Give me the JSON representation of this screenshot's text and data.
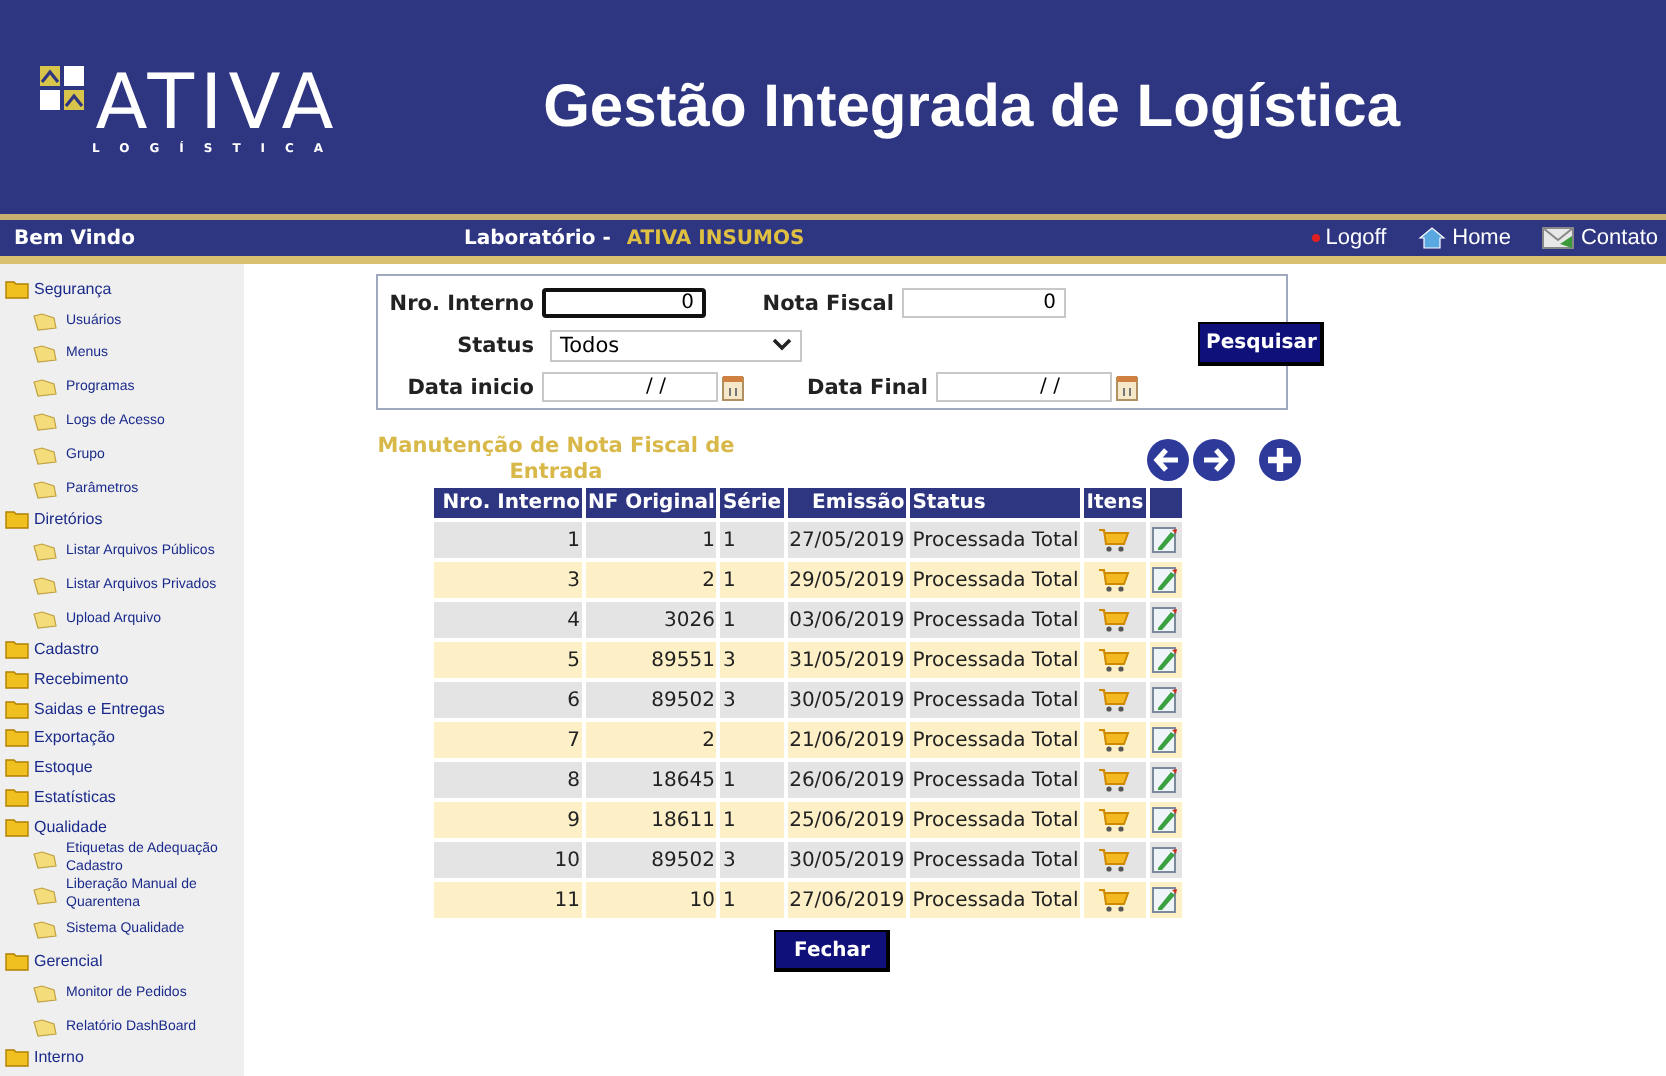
{
  "header": {
    "logo": {
      "name": "ATIVA",
      "tagline": "LOGÍSTICA"
    },
    "title": "Gestão Integrada de Logística"
  },
  "navbar": {
    "welcome": "Bem Vindo",
    "lab_label": "Laboratório -",
    "lab_value": "ATIVA INSUMOS",
    "links": [
      {
        "label": "Logoff",
        "kind": "dot"
      },
      {
        "label": "Home",
        "kind": "house"
      },
      {
        "label": "Contato",
        "kind": "mail"
      }
    ]
  },
  "sidebar": {
    "items": [
      {
        "label": "Segurança",
        "children": [
          {
            "label": "Usuários"
          },
          {
            "label": "Menus"
          },
          {
            "label": "Programas"
          },
          {
            "label": "Logs de Acesso"
          },
          {
            "label": "Grupo"
          },
          {
            "label": "Parâmetros"
          }
        ]
      },
      {
        "label": "Diretórios",
        "children": [
          {
            "label": "Listar Arquivos Públicos"
          },
          {
            "label": "Listar Arquivos Privados"
          },
          {
            "label": "Upload Arquivo"
          }
        ]
      },
      {
        "label": "Cadastro"
      },
      {
        "label": "Recebimento"
      },
      {
        "label": "Saidas e Entregas"
      },
      {
        "label": "Exportação"
      },
      {
        "label": "Estoque"
      },
      {
        "label": "Estatísticas"
      },
      {
        "label": "Qualidade",
        "children": [
          {
            "label": "Etiquetas de Adequação Cadastro"
          },
          {
            "label": "Liberação Manual de Quarentena"
          },
          {
            "label": "Sistema Qualidade"
          }
        ]
      },
      {
        "label": "Gerencial",
        "children": [
          {
            "label": "Monitor de Pedidos"
          },
          {
            "label": "Relatório DashBoard"
          }
        ]
      },
      {
        "label": "Interno"
      }
    ]
  },
  "filter": {
    "nro_interno": {
      "label": "Nro. Interno",
      "value": "0",
      "focused": true
    },
    "nota_fiscal": {
      "label": "Nota Fiscal",
      "value": "0",
      "focused": false
    },
    "status": {
      "label": "Status",
      "value": "Todos"
    },
    "data_inicio": {
      "label": "Data inicio",
      "value": "/ /"
    },
    "data_final": {
      "label": "Data Final",
      "value": "/ /"
    },
    "search_button": "Pesquisar"
  },
  "list": {
    "title": "Manutenção de Nota Fiscal de Entrada",
    "columns": [
      "Nro. Interno",
      "NF Original",
      "Série",
      "Emissão",
      "Status",
      "Itens"
    ],
    "rows": [
      {
        "nro_interno": "1",
        "nf_original": "1",
        "serie": "1",
        "emissao": "27/05/2019",
        "status": "Processada Total"
      },
      {
        "nro_interno": "3",
        "nf_original": "2",
        "serie": "1",
        "emissao": "29/05/2019",
        "status": "Processada Total"
      },
      {
        "nro_interno": "4",
        "nf_original": "3026",
        "serie": "1",
        "emissao": "03/06/2019",
        "status": "Processada Total"
      },
      {
        "nro_interno": "5",
        "nf_original": "89551",
        "serie": "3",
        "emissao": "31/05/2019",
        "status": "Processada Total"
      },
      {
        "nro_interno": "6",
        "nf_original": "89502",
        "serie": "3",
        "emissao": "30/05/2019",
        "status": "Processada Total"
      },
      {
        "nro_interno": "7",
        "nf_original": "2",
        "serie": "",
        "emissao": "21/06/2019",
        "status": "Processada Total"
      },
      {
        "nro_interno": "8",
        "nf_original": "18645",
        "serie": "1",
        "emissao": "26/06/2019",
        "status": "Processada Total"
      },
      {
        "nro_interno": "9",
        "nf_original": "18611",
        "serie": "1",
        "emissao": "25/06/2019",
        "status": "Processada Total"
      },
      {
        "nro_interno": "10",
        "nf_original": "89502",
        "serie": "3",
        "emissao": "30/05/2019",
        "status": "Processada Total"
      },
      {
        "nro_interno": "11",
        "nf_original": "10",
        "serie": "1",
        "emissao": "27/06/2019",
        "status": "Processada Total"
      }
    ],
    "close_button": "Fechar"
  }
}
